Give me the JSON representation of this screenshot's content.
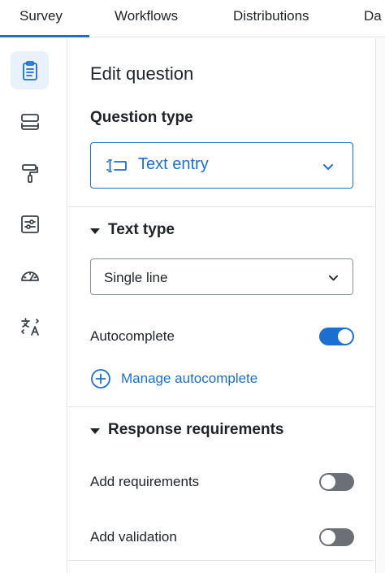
{
  "tabs": [
    {
      "label": "Survey",
      "active": true
    },
    {
      "label": "Workflows"
    },
    {
      "label": "Distributions"
    },
    {
      "label": "Da"
    }
  ],
  "rail_icons": [
    "survey-clipboard-icon",
    "blocks-layout-icon",
    "paint-roller-icon",
    "settings-sliders-icon",
    "gauge-icon",
    "translate-icon"
  ],
  "panel": {
    "heading": "Edit question",
    "question_type_label": "Question type",
    "question_type_value": "Text entry",
    "text_type": {
      "title": "Text type",
      "select_value": "Single line",
      "autocomplete_label": "Autocomplete",
      "autocomplete_on": true,
      "manage_link": "Manage autocomplete"
    },
    "response_requirements": {
      "title": "Response requirements",
      "add_requirements_label": "Add requirements",
      "add_requirements_on": false,
      "add_validation_label": "Add validation",
      "add_validation_on": false
    }
  },
  "colors": {
    "accent": "#1a6fd0",
    "active_bg": "#e9f1fb",
    "toggle_off": "#6b7077",
    "divider": "#e3e5e8"
  }
}
